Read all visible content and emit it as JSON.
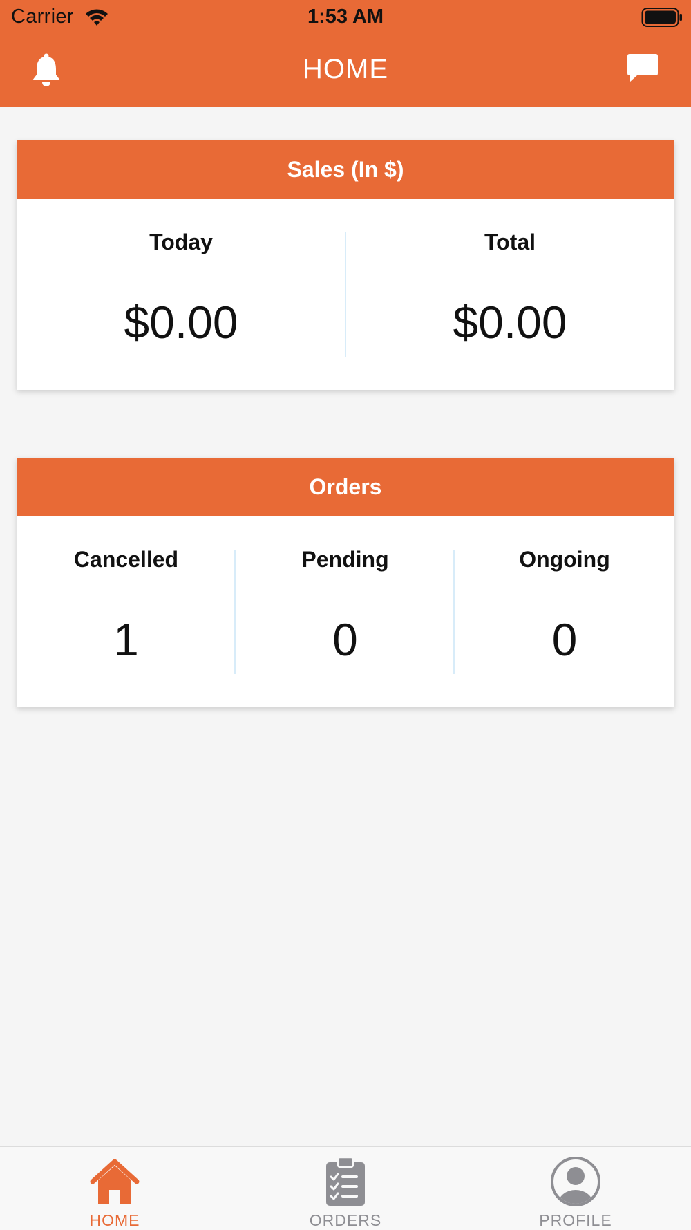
{
  "status_bar": {
    "carrier": "Carrier",
    "time": "1:53 AM"
  },
  "header": {
    "title": "HOME",
    "left_icon": "bell-icon",
    "right_icon": "chat-icon"
  },
  "sales_card": {
    "title": "Sales (In $)",
    "columns": [
      {
        "label": "Today",
        "value": "$0.00"
      },
      {
        "label": "Total",
        "value": "$0.00"
      }
    ]
  },
  "orders_card": {
    "title": "Orders",
    "columns": [
      {
        "label": "Cancelled",
        "value": "1"
      },
      {
        "label": "Pending",
        "value": "0"
      },
      {
        "label": "Ongoing",
        "value": "0"
      }
    ]
  },
  "tabs": [
    {
      "label": "HOME",
      "icon": "home-icon",
      "active": true
    },
    {
      "label": "ORDERS",
      "icon": "clipboard-icon",
      "active": false
    },
    {
      "label": "PROFILE",
      "icon": "profile-icon",
      "active": false
    }
  ],
  "colors": {
    "accent": "#e86a36",
    "background": "#f5f5f5",
    "divider": "#d8ecf9",
    "inactive_tab": "#8e8e93"
  }
}
